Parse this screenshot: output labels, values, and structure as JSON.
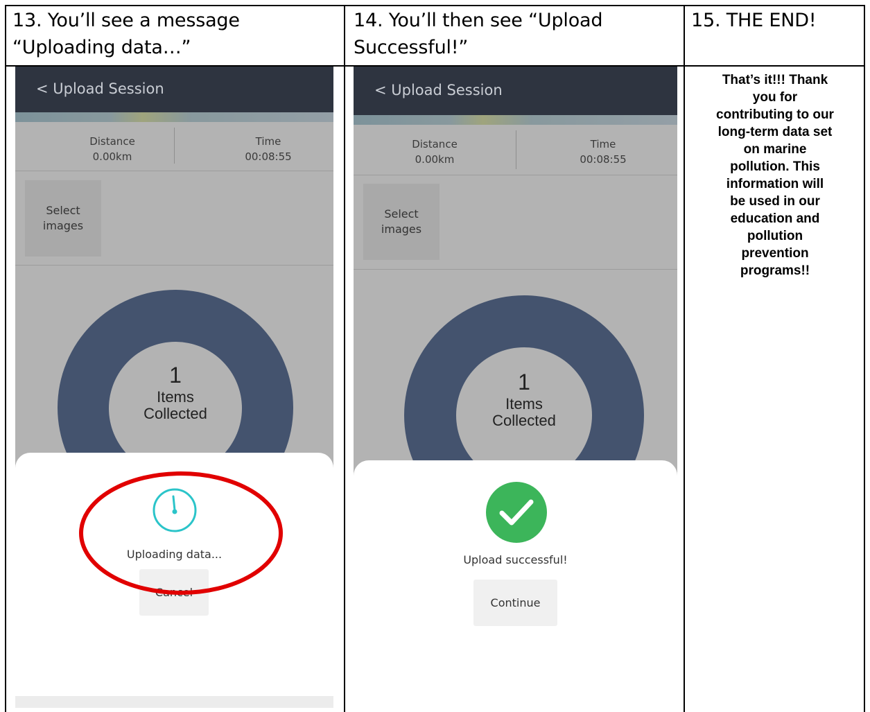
{
  "headers": {
    "step13": [
      "13. You’ll see a message",
      "“Uploading data…”"
    ],
    "step14": [
      "14. You’ll then see “Upload",
      "Successful!”"
    ],
    "step15": [
      "15. THE END!"
    ]
  },
  "screen13": {
    "back_title": "< Upload Session",
    "distance_label": "Distance",
    "distance_value": "0.00km",
    "time_label": "Time",
    "time_value": "00:08:55",
    "select_images": [
      "Select",
      "images"
    ],
    "items_count": "1",
    "items_label": [
      "Items",
      "Collected"
    ],
    "status_message": "Uploading data...",
    "cancel_label": "Cancel",
    "icon": "clock-icon"
  },
  "screen14": {
    "back_title": "< Upload Session",
    "distance_label": "Distance",
    "distance_value": "0.00km",
    "time_label": "Time",
    "time_value": "00:08:55",
    "select_images": [
      "Select",
      "images"
    ],
    "items_count": "1",
    "items_label": [
      "Items",
      "Collected"
    ],
    "status_message": "Upload successful!",
    "continue_label": "Continue",
    "icon": "checkmark-icon"
  },
  "end_message": [
    "That’s it!!! Thank",
    "you for",
    "contributing to our",
    "long-term data set",
    "on marine",
    "pollution. This",
    "information will",
    "be used in our",
    "education and",
    "pollution",
    "prevention",
    "programs!!"
  ],
  "colors": {
    "appbar": "#2e3440",
    "ring": "#44536e",
    "spinner": "#2bc4c9",
    "success": "#3cb55a",
    "annotation": "#e10000"
  }
}
